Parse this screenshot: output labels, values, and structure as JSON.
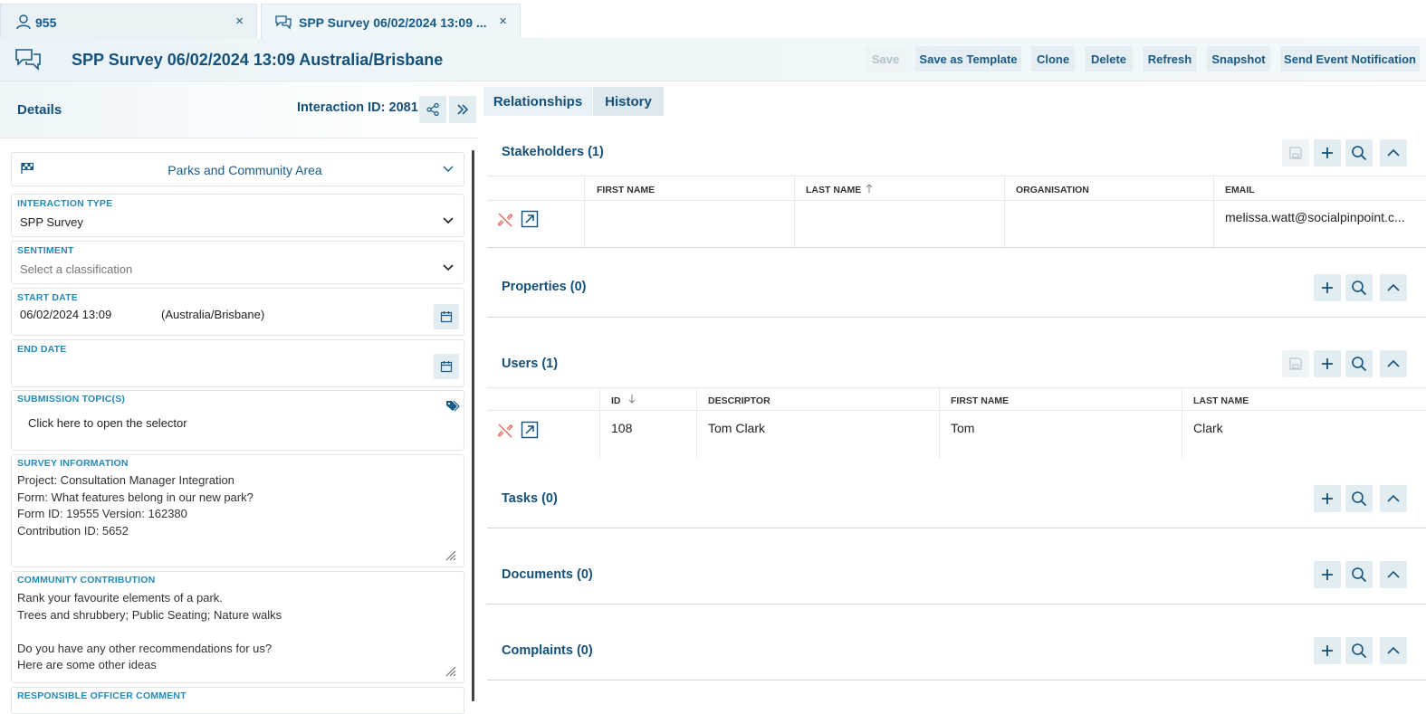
{
  "tabs": [
    {
      "label": "955",
      "close": "×"
    },
    {
      "label": "SPP Survey 06/02/2024 13:09 ...",
      "close": "×"
    }
  ],
  "header": {
    "title": "SPP Survey 06/02/2024 13:09 Australia/Brisbane",
    "buttons": [
      "Save",
      "Save as Template",
      "Clone",
      "Delete",
      "Refresh",
      "Snapshot",
      "Send Event Notification"
    ]
  },
  "details": {
    "title": "Details",
    "interaction_id": "Interaction ID: 2081",
    "area": "Parks and Community Area",
    "interaction_type": {
      "label": "INTERACTION TYPE",
      "value": "SPP Survey"
    },
    "sentiment": {
      "label": "SENTIMENT",
      "placeholder": "Select a classification"
    },
    "start_date": {
      "label": "START DATE",
      "value": "06/02/2024 13:09",
      "tz": "(Australia/Brisbane)"
    },
    "end_date": {
      "label": "END DATE",
      "value": ""
    },
    "topics": {
      "label": "SUBMISSION TOPIC(S)",
      "value": "Click here to open the selector"
    },
    "survey_info": {
      "label": "SURVEY INFORMATION",
      "text": "Project: Consultation Manager Integration\nForm: What features belong in our new park?\nForm ID: 19555 Version: 162380\nContribution ID: 5652"
    },
    "community": {
      "label": "COMMUNITY CONTRIBUTION",
      "text": "Rank your favourite elements of a park.\nTrees and shrubbery; Public Seating; Nature walks\n\nDo you have any other recommendations for us?\nHere are some other ideas"
    },
    "officer_comment": {
      "label": "RESPONSIBLE OFFICER COMMENT"
    }
  },
  "right_tabs": [
    "Relationships",
    "History"
  ],
  "sections": {
    "stakeholders": {
      "title": "Stakeholders (1)",
      "columns": [
        "FIRST NAME",
        "LAST NAME",
        "ORGANISATION",
        "EMAIL"
      ],
      "rows": [
        [
          "",
          "",
          "",
          "melissa.watt@socialpinpoint.c..."
        ]
      ]
    },
    "properties": {
      "title": "Properties (0)"
    },
    "users": {
      "title": "Users (1)",
      "columns": [
        "ID",
        "DESCRIPTOR",
        "FIRST NAME",
        "LAST NAME"
      ],
      "rows": [
        [
          "108",
          "Tom Clark",
          "Tom",
          "Clark"
        ]
      ]
    },
    "tasks": {
      "title": "Tasks (0)"
    },
    "documents": {
      "title": "Documents (0)"
    },
    "complaints": {
      "title": "Complaints (0)"
    }
  },
  "colors": {
    "accent": "#15507a",
    "label": "#2489b8",
    "unlink": "#e06a5c"
  }
}
